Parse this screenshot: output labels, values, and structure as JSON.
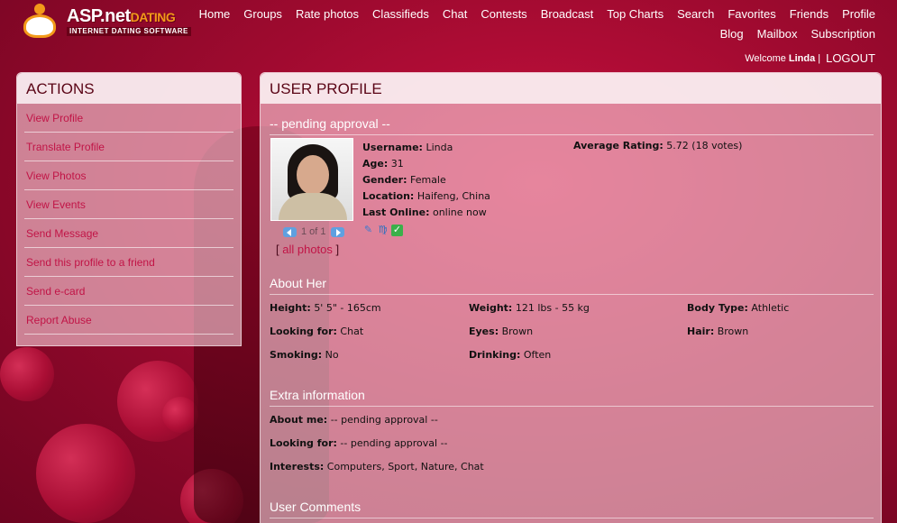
{
  "logo": {
    "brand_main": "ASP.net",
    "brand_accent": "DATING",
    "tagline": "INTERNET DATING SOFTWARE"
  },
  "nav": {
    "row1": [
      "Home",
      "Groups",
      "Rate photos",
      "Classifieds",
      "Chat",
      "Contests",
      "Broadcast",
      "Top Charts",
      "Search",
      "Favorites",
      "Friends",
      "Profile"
    ],
    "row2": [
      "Blog",
      "Mailbox",
      "Subscription"
    ]
  },
  "welcome": {
    "label": "Welcome",
    "user": "Linda",
    "sep": "|",
    "logout": "LOGOUT"
  },
  "actions": {
    "title": "ACTIONS",
    "items": [
      "View Profile",
      "Translate Profile",
      "View Photos",
      "View Events",
      "Send Message",
      "Send this profile to a friend",
      "Send e-card",
      "Report Abuse"
    ]
  },
  "profile": {
    "title": "USER PROFILE",
    "status": "-- pending approval --",
    "username_label": "Username:",
    "username": "Linda",
    "age_label": "Age:",
    "age": "31",
    "gender_label": "Gender:",
    "gender": "Female",
    "location_label": "Location:",
    "location": "Haifeng, China",
    "online_label": "Last Online:",
    "online": "online now",
    "rating_label": "Average Rating:",
    "rating": "5.72 (18 votes)",
    "pager": "1 of 1",
    "all_photos": "all photos",
    "bracket_open": "[",
    "bracket_close": "]"
  },
  "about": {
    "title": "About Her",
    "fields": [
      {
        "label": "Height:",
        "value": "5' 5\" - 165cm"
      },
      {
        "label": "Weight:",
        "value": "121 lbs - 55 kg"
      },
      {
        "label": "Body Type:",
        "value": "Athletic"
      },
      {
        "label": "Looking for:",
        "value": "Chat"
      },
      {
        "label": "Eyes:",
        "value": "Brown"
      },
      {
        "label": "Hair:",
        "value": "Brown"
      },
      {
        "label": "Smoking:",
        "value": "No"
      },
      {
        "label": "Drinking:",
        "value": "Often"
      }
    ]
  },
  "extra": {
    "title": "Extra information",
    "fields": [
      {
        "label": "About me:",
        "value": "-- pending approval --"
      },
      {
        "label": "Looking for:",
        "value": "-- pending approval --"
      },
      {
        "label": "Interests:",
        "value": "Computers, Sport, Nature, Chat"
      }
    ]
  },
  "comments": {
    "title": "User Comments"
  },
  "icons": [
    "pencil-icon",
    "zodiac-icon",
    "verified-check-icon",
    "arrow-left-icon",
    "arrow-right-icon"
  ],
  "colors": {
    "link": "#c11446",
    "panel_head_text": "#5a0516",
    "brand_accent": "#f39a1a"
  }
}
